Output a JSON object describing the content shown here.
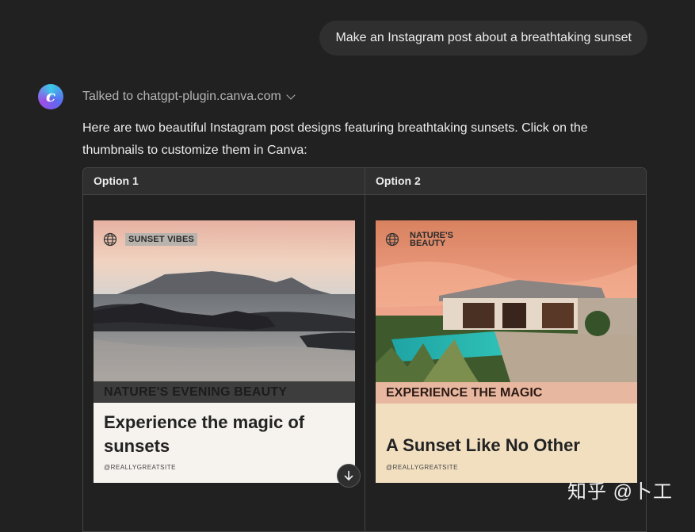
{
  "user_message": "Make an Instagram post about a breathtaking sunset",
  "assistant": {
    "avatar_letter": "c",
    "plugin_text": "Talked to chatgpt-plugin.canva.com",
    "intro": "Here are two beautiful Instagram post designs featuring breathtaking sunsets. Click on the thumbnails to customize them in Canva:"
  },
  "table": {
    "headers": [
      "Option 1",
      "Option 2"
    ],
    "option1": {
      "tag": "SUNSET VIBES",
      "band": "NATURE'S EVENING BEAUTY",
      "headline": "Experience the magic of sunsets",
      "site": "@REALLYGREATSITE"
    },
    "option2": {
      "tag": "NATURE'S BEAUTY",
      "band": "EXPERIENCE THE MAGIC",
      "headline": "A Sunset Like No Other",
      "site": "@REALLYGREATSITE"
    }
  },
  "watermark": "知乎 @卜工",
  "icons": {
    "avatar": "canva-logo-icon",
    "chevron": "chevron-down-icon",
    "globe": "globe-icon",
    "scroll": "arrow-down-icon"
  }
}
